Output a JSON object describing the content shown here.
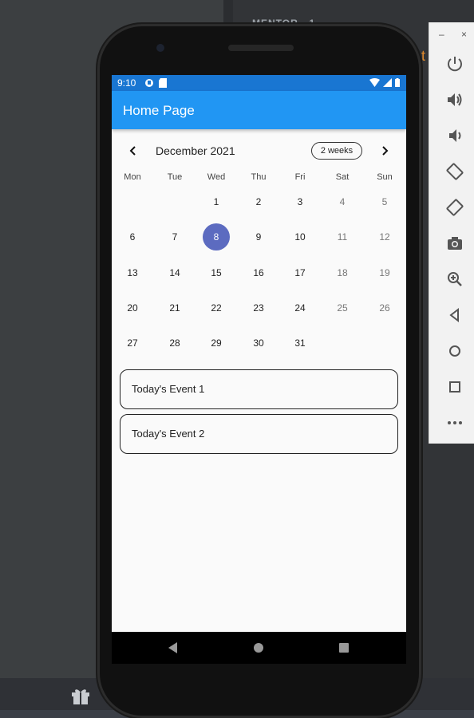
{
  "ide": {
    "header_text": "MENTOR · 1",
    "orange_text": "t"
  },
  "status_bar": {
    "time": "9:10"
  },
  "app_bar": {
    "title": "Home Page"
  },
  "calendar": {
    "month_title": "December 2021",
    "format_button": "2 weeks",
    "weekdays": [
      "Mon",
      "Tue",
      "Wed",
      "Thu",
      "Fri",
      "Sat",
      "Sun"
    ],
    "weeks": [
      [
        "",
        "",
        "1",
        "2",
        "3",
        "4",
        "5"
      ],
      [
        "6",
        "7",
        "8",
        "9",
        "10",
        "11",
        "12"
      ],
      [
        "13",
        "14",
        "15",
        "16",
        "17",
        "18",
        "19"
      ],
      [
        "20",
        "21",
        "22",
        "23",
        "24",
        "25",
        "26"
      ],
      [
        "27",
        "28",
        "29",
        "30",
        "31",
        "",
        ""
      ]
    ],
    "selected_day": "8"
  },
  "events": [
    "Today's Event 1",
    "Today's Event 2"
  ],
  "emulator_panel": {
    "minimize": "–",
    "close": "×",
    "icons": [
      "power-icon",
      "volume-up-icon",
      "volume-down-icon",
      "rotate-left-icon",
      "rotate-right-icon",
      "camera-icon",
      "zoom-icon",
      "back-icon",
      "home-icon",
      "overview-icon",
      "more-icon"
    ]
  },
  "colors": {
    "appbar": "#2196f3",
    "statusbar": "#1976d2",
    "selected": "#5c6bc0"
  }
}
